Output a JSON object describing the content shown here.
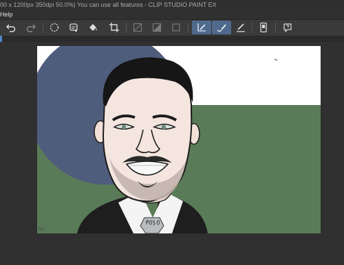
{
  "window": {
    "title": "00 x 1200px 350dpi 50.0%)  You can use all features - CLIP STUDIO PAINT EX"
  },
  "menu": {
    "items": [
      "Help"
    ]
  },
  "toolbar": {
    "buttons": [
      {
        "name": "undo-icon",
        "active": false,
        "enabled": true
      },
      {
        "name": "redo-icon",
        "active": false,
        "enabled": false
      },
      {
        "name": "clear-selection-icon",
        "active": false,
        "enabled": true
      },
      {
        "name": "fill-icon",
        "active": false,
        "enabled": true
      },
      {
        "name": "fill-bucket-icon",
        "active": false,
        "enabled": true
      },
      {
        "name": "crop-icon",
        "active": false,
        "enabled": true
      },
      {
        "name": "mask-off-icon",
        "active": false,
        "enabled": false
      },
      {
        "name": "mask-gray-icon",
        "active": false,
        "enabled": false
      },
      {
        "name": "mask-box-icon",
        "active": false,
        "enabled": false
      },
      {
        "name": "ruler-pen-icon",
        "active": true,
        "enabled": true
      },
      {
        "name": "stabilize-pen-icon",
        "active": true,
        "enabled": true
      },
      {
        "name": "brush-icon",
        "active": false,
        "enabled": true
      },
      {
        "name": "tablet-icon",
        "active": false,
        "enabled": true
      },
      {
        "name": "help-icon",
        "active": false,
        "enabled": true
      }
    ]
  },
  "canvas": {
    "colors": {
      "background": "#ffffff",
      "blue_circle": "#4f5d7d",
      "green_ground": "#5a7b57"
    },
    "corner_label": "RD"
  }
}
